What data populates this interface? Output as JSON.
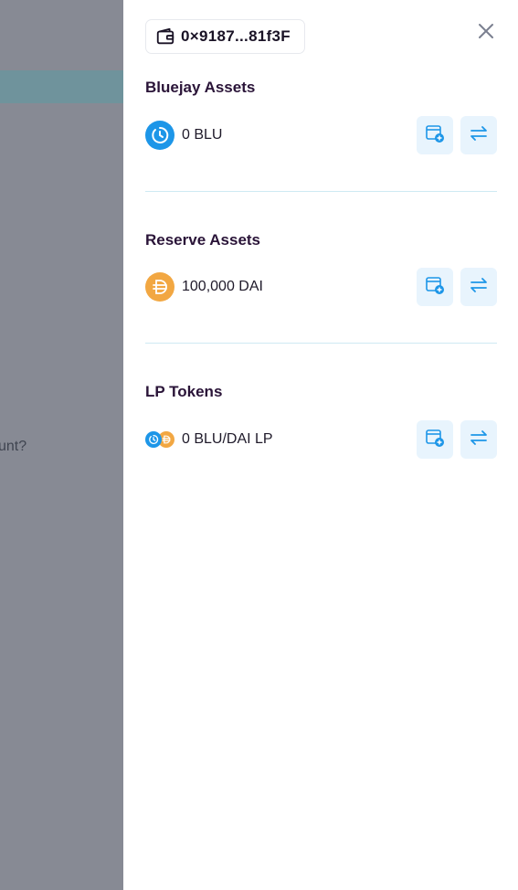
{
  "background": {
    "partial_text": "unt?"
  },
  "drawer": {
    "wallet_address": "0×9187...81f3F",
    "sections": [
      {
        "title": "Bluejay Assets",
        "amount": "0 BLU",
        "token": "blu"
      },
      {
        "title": "Reserve Assets",
        "amount": "100,000 DAI",
        "token": "dai"
      },
      {
        "title": "LP Tokens",
        "amount": "0 BLU/DAI LP",
        "token": "lp"
      }
    ]
  },
  "colors": {
    "accent_blue": "#1d96e8",
    "dai_orange": "#f2a742",
    "title_text": "#2a1438",
    "action_bg": "#e8f4fd",
    "divider": "#cfeaf3"
  },
  "icons": [
    "wallet-icon",
    "close-icon",
    "blu-token-icon",
    "dai-token-icon",
    "add-to-wallet-icon",
    "swap-icon"
  ]
}
